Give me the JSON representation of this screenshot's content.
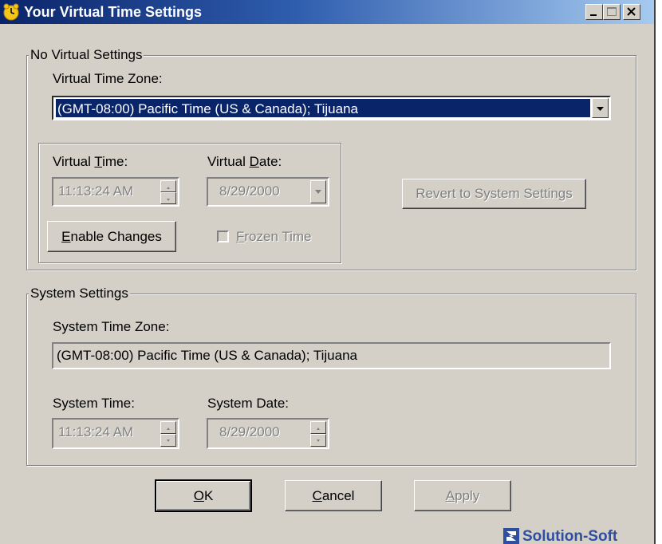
{
  "window": {
    "title": "Your Virtual Time Settings",
    "icon": "clock-face-icon"
  },
  "virtual_group": {
    "legend": "No Virtual Settings",
    "timezone_label": "Virtual Time Zone:",
    "timezone_value": "(GMT-08:00) Pacific Time (US & Canada); Tijuana",
    "time_label_pre": "Virtual ",
    "time_label_key": "T",
    "time_label_post": "ime:",
    "date_label_pre": "Virtual ",
    "date_label_key": "D",
    "date_label_post": "ate:",
    "time_value": "11:13:24 AM",
    "date_value": "8/29/2000",
    "enable_pre": "",
    "enable_key": "E",
    "enable_post": "nable Changes",
    "frozen_pre": "",
    "frozen_key": "F",
    "frozen_post": "rozen Time",
    "revert_label": "Revert to System Settings"
  },
  "system_group": {
    "legend": "System Settings",
    "timezone_label": "System Time Zone:",
    "timezone_value": "(GMT-08:00) Pacific Time (US & Canada); Tijuana",
    "time_label": "System Time:",
    "date_label": "System Date:",
    "time_value": "11:13:24 AM",
    "date_value": "8/29/2000"
  },
  "buttons": {
    "ok_key": "O",
    "ok_post": "K",
    "cancel_key": "C",
    "cancel_post": "ancel",
    "apply_key": "A",
    "apply_post": "pply"
  },
  "branding": {
    "logo_text": "Solution-Soft",
    "logo_icon": "solution-soft-logo-icon",
    "brand_color": "#2e4fa0"
  },
  "colors": {
    "titlebar_start": "#0a246a",
    "titlebar_end": "#a6caf0",
    "face": "#d4d0c8",
    "selection": "#0a246a"
  }
}
